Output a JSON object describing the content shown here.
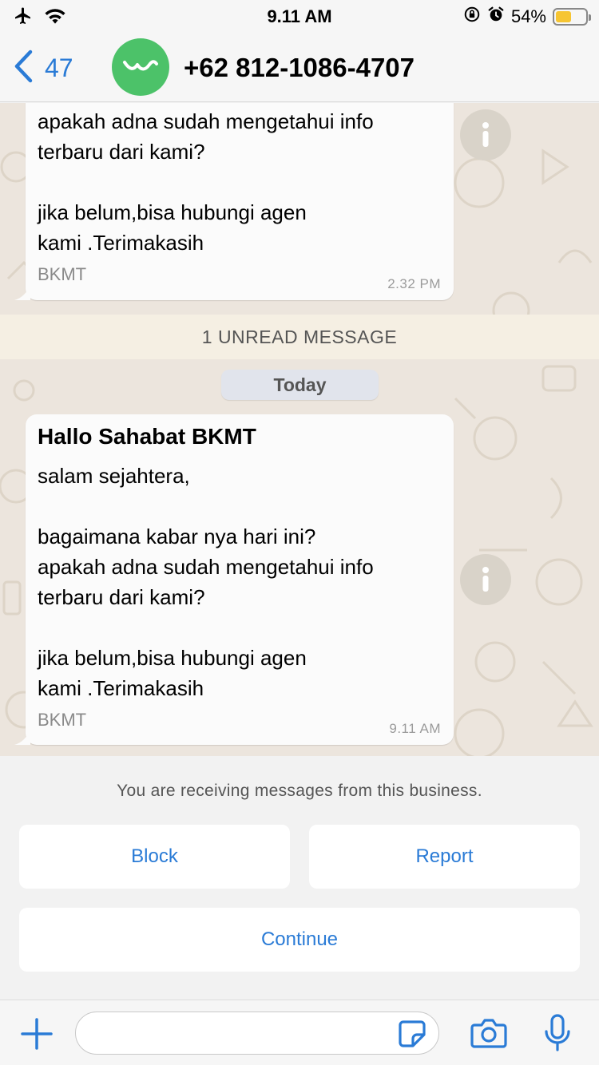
{
  "status_bar": {
    "time": "9.11 AM",
    "battery_percent": "54%",
    "battery_level": 0.54
  },
  "header": {
    "back_count": "47",
    "contact_name": "+62 812-1086-4707"
  },
  "messages": [
    {
      "title": "",
      "body": "apakah adna sudah mengetahui info\nterbaru dari kami?\n\njika belum,bisa hubungi agen\nkami .Terimakasih",
      "footer": "BKMT",
      "time": "2.32 PM"
    },
    {
      "title": "Hallo Sahabat BKMT",
      "body": "salam sejahtera,\n\nbagaimana kabar nya hari ini?\napakah adna sudah mengetahui info\nterbaru dari kami?\n\njika belum,bisa hubungi agen\nkami .Terimakasih",
      "footer": "BKMT",
      "time": "9.11 AM"
    }
  ],
  "unread_banner": "1 UNREAD MESSAGE",
  "date_divider": "Today",
  "business_panel": {
    "notice": "You are receiving messages from this business.",
    "block_label": "Block",
    "report_label": "Report",
    "continue_label": "Continue"
  },
  "input": {
    "placeholder": ""
  },
  "colors": {
    "accent": "#2a7bd6",
    "avatar_bg": "#4cc269",
    "chat_bg": "#ece5dd",
    "battery": "#f6c532"
  }
}
